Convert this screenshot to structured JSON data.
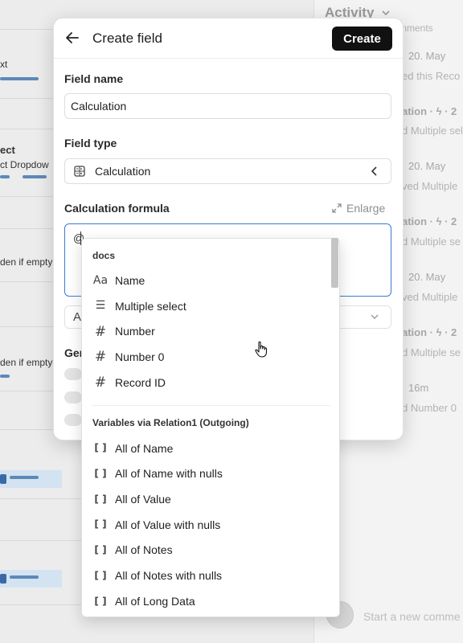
{
  "background_form": {
    "snippets": [
      {
        "text": "xt"
      },
      {
        "text": "ect"
      },
      {
        "text": "ct  Dropdow"
      },
      {
        "text": "den if empty"
      },
      {
        "text": "den if empty"
      }
    ]
  },
  "activity": {
    "title": "Activity",
    "header_right": "mments",
    "entries": [
      {
        "date": "20. May",
        "line": "ed this Reco"
      },
      {
        "head": "ation · ϟ · 2",
        "line": "d Multiple sel"
      },
      {
        "date": "20. May",
        "line": "ved Multiple"
      },
      {
        "head": "ation · ϟ · 2",
        "line": "d Multiple se"
      },
      {
        "date": "20. May",
        "line": "ved Multiple"
      },
      {
        "head": "ation · ϟ · 2",
        "line": "d Multiple se"
      },
      {
        "date": "16m",
        "line": "d Number 0"
      }
    ],
    "comment_placeholder": "Start a new comme"
  },
  "modal": {
    "title": "Create field",
    "create_label": "Create",
    "field_name_label": "Field name",
    "field_name_value": "Calculation",
    "field_type_label": "Field type",
    "field_type_value": "Calculation",
    "formula_label": "Calculation formula",
    "enlarge_label": "Enlarge",
    "formula_value": "@",
    "select_value": "A",
    "general_label": "Gen"
  },
  "dropdown": {
    "sections": [
      {
        "title": "docs",
        "items": [
          {
            "icon": "Aa",
            "icon_name": "text-type-icon",
            "label": "Name"
          },
          {
            "icon": "☰",
            "icon_name": "list-type-icon",
            "label": "Multiple select"
          },
          {
            "icon": "#",
            "icon_name": "hash-icon",
            "label": "Number"
          },
          {
            "icon": "#",
            "icon_name": "hash-icon",
            "label": "Number 0"
          },
          {
            "icon": "#",
            "icon_name": "hash-icon",
            "label": "Record ID"
          }
        ]
      },
      {
        "title": "Variables via Relation1 (Outgoing)",
        "items": [
          {
            "icon": "[ ]",
            "icon_name": "array-icon",
            "label": "All of Name"
          },
          {
            "icon": "[ ]",
            "icon_name": "array-icon",
            "label": "All of Name with nulls"
          },
          {
            "icon": "[ ]",
            "icon_name": "array-icon",
            "label": "All of Value"
          },
          {
            "icon": "[ ]",
            "icon_name": "array-icon",
            "label": "All of Value with nulls"
          },
          {
            "icon": "[ ]",
            "icon_name": "array-icon",
            "label": "All of Notes"
          },
          {
            "icon": "[ ]",
            "icon_name": "array-icon",
            "label": "All of Notes with nulls"
          },
          {
            "icon": "[ ]",
            "icon_name": "array-icon",
            "label": "All of Long Data"
          }
        ]
      }
    ]
  },
  "colors": {
    "accent": "#3b7bd4",
    "button": "#111111",
    "background": "#ececec"
  }
}
